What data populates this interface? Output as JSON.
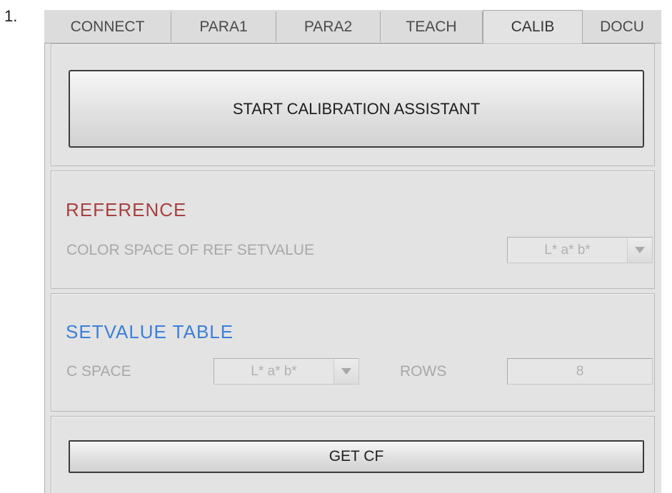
{
  "step_label": "1.",
  "tabs": [
    {
      "label": "CONNECT",
      "active": false
    },
    {
      "label": "PARA1",
      "active": false
    },
    {
      "label": "PARA2",
      "active": false
    },
    {
      "label": "TEACH",
      "active": false
    },
    {
      "label": "CALIB",
      "active": true
    },
    {
      "label": "DOCU",
      "active": false
    }
  ],
  "calibration": {
    "start_button_label": "START CALIBRATION ASSISTANT"
  },
  "reference": {
    "title": "REFERENCE",
    "color_space_label": "COLOR SPACE OF REF SETVALUE",
    "color_space_value": "L* a* b*"
  },
  "setvalue_table": {
    "title": "SETVALUE TABLE",
    "c_space_label": "C SPACE",
    "c_space_value": "L* a* b*",
    "rows_label": "ROWS",
    "rows_value": "8"
  },
  "get_cf": {
    "button_label": "GET CF"
  },
  "colors": {
    "reference_title": "#a84040",
    "setvalue_title": "#3b7fd9",
    "disabled_text": "#a8a8a8",
    "panel_bg": "#e3e3e3"
  },
  "icons": {
    "dropdown_arrow": "triangle-down"
  }
}
